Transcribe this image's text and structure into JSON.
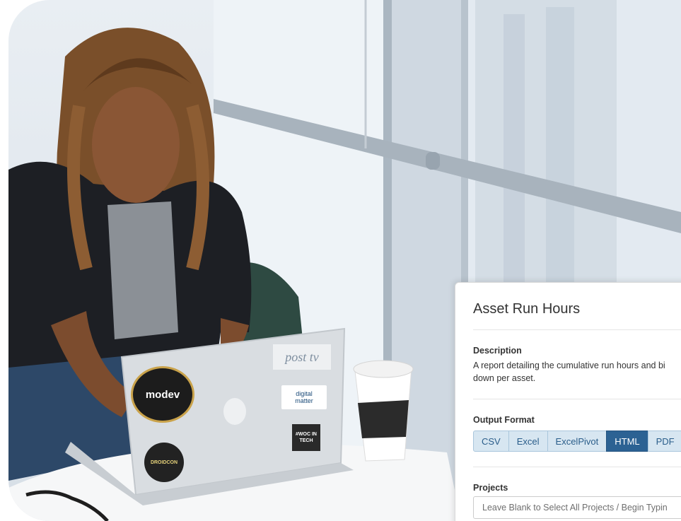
{
  "card": {
    "title": "Asset Run Hours",
    "description_label": "Description",
    "description_text": "A report detailing the cumulative run hours and bi down per asset.",
    "output_format_label": "Output Format",
    "formats": [
      "CSV",
      "Excel",
      "ExcelPivot",
      "HTML",
      "PDF"
    ],
    "selected_format": "HTML",
    "projects_label": "Projects",
    "projects_placeholder": "Leave Blank to Select All Projects / Begin Typin"
  },
  "stickers": {
    "post_tv": "post tv",
    "modev": "modev",
    "digital_matter": "digital matter",
    "woc_in_tech": "#WOC IN TECH",
    "droidcon": "DROIDCON"
  },
  "colors": {
    "accent_active": "#2c6293",
    "button_inactive": "#d7e6f1",
    "text_primary": "#333333"
  }
}
